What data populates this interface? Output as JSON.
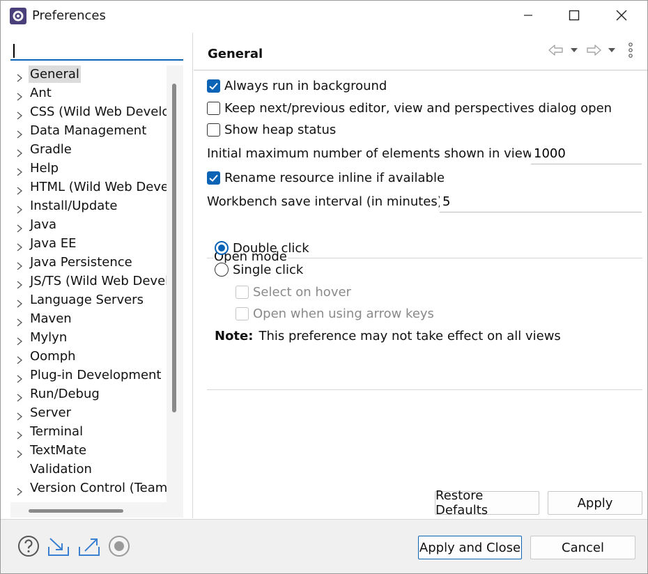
{
  "window": {
    "title": "Preferences",
    "controls": {
      "minimize": "minimize-icon",
      "maximize": "maximize-icon",
      "close": "close-icon"
    }
  },
  "filter": {
    "value": "",
    "placeholder": ""
  },
  "tree": {
    "items": [
      {
        "label": "General",
        "expandable": true,
        "selected": true
      },
      {
        "label": "Ant",
        "expandable": true
      },
      {
        "label": "CSS (Wild Web Develo",
        "expandable": true
      },
      {
        "label": "Data Management",
        "expandable": true
      },
      {
        "label": "Gradle",
        "expandable": true
      },
      {
        "label": "Help",
        "expandable": true
      },
      {
        "label": "HTML (Wild Web Deve",
        "expandable": true
      },
      {
        "label": "Install/Update",
        "expandable": true
      },
      {
        "label": "Java",
        "expandable": true
      },
      {
        "label": "Java EE",
        "expandable": true
      },
      {
        "label": "Java Persistence",
        "expandable": true
      },
      {
        "label": "JS/TS (Wild Web Devel",
        "expandable": true
      },
      {
        "label": "Language Servers",
        "expandable": true
      },
      {
        "label": "Maven",
        "expandable": true
      },
      {
        "label": "Mylyn",
        "expandable": true
      },
      {
        "label": "Oomph",
        "expandable": true
      },
      {
        "label": "Plug-in Development",
        "expandable": true
      },
      {
        "label": "Run/Debug",
        "expandable": true
      },
      {
        "label": "Server",
        "expandable": true
      },
      {
        "label": "Terminal",
        "expandable": true
      },
      {
        "label": "TextMate",
        "expandable": true
      },
      {
        "label": "Validation",
        "expandable": false
      },
      {
        "label": "Version Control (Team)",
        "expandable": true
      }
    ]
  },
  "page": {
    "title": "General",
    "header_icons": [
      "back-arrow-icon",
      "chevron-down-icon",
      "forward-arrow-icon",
      "chevron-down-icon",
      "vertical-ellipsis-icon"
    ],
    "always_run_background": {
      "label": "Always run in background",
      "checked": true
    },
    "keep_next_prev": {
      "label": "Keep next/previous editor, view and perspectives dialog open",
      "checked": false
    },
    "show_heap": {
      "label": "Show heap status",
      "checked": false
    },
    "initial_max": {
      "label": "Initial maximum number of elements shown in views:",
      "value": "1000"
    },
    "rename_inline": {
      "label": "Rename resource inline if available",
      "checked": true
    },
    "save_interval": {
      "label": "Workbench save interval (in minutes):",
      "value": "5"
    },
    "open_mode": {
      "title": "Open mode",
      "double_click": {
        "label": "Double click",
        "selected": true
      },
      "single_click": {
        "label": "Single click",
        "selected": false
      },
      "select_on_hover": {
        "label": "Select on hover",
        "checked": false,
        "enabled": false
      },
      "open_arrow_keys": {
        "label": "Open when using arrow keys",
        "checked": false,
        "enabled": false
      },
      "note_label": "Note:",
      "note_text": "This preference may not take effect on all views"
    },
    "restore_defaults": "Restore Defaults",
    "apply": "Apply"
  },
  "footer": {
    "icons": [
      "help-icon",
      "import-icon",
      "export-icon",
      "record-icon"
    ],
    "apply_and_close": "Apply and Close",
    "cancel": "Cancel"
  },
  "colors": {
    "accent": "#0b63b6",
    "panel_bg": "#f0f0f0",
    "selection": "#dcdcdc"
  }
}
